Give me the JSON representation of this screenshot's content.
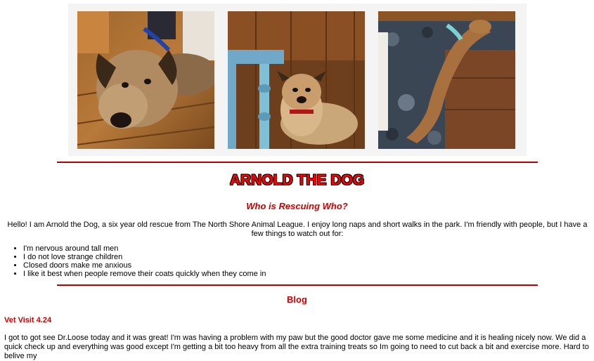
{
  "photos": [
    {
      "alt": "Arnold lying on a wooden floor"
    },
    {
      "alt": "Arnold sitting under a table"
    },
    {
      "alt": "Arnold stretched out on a rug"
    }
  ],
  "header": {
    "title": "ARNOLD THE DOG",
    "subtitle": "Who is Rescuing Who?"
  },
  "intro": {
    "text": "Hello! I am Arnold the Dog, a six year old rescue from The North Shore Animal League. I enjoy long naps and short walks in the park. I'm friendly with people, but I have a few things to watch out for:"
  },
  "watch_list": [
    "I'm nervous around tall men",
    "I do not love strange children",
    "Closed doors make me anxious",
    "I like it best when people remove their coats quickly when they come in"
  ],
  "blog": {
    "heading": "Blog",
    "post_title": "Vet Visit 4.24",
    "post_body": "I got to got see Dr.Loose today and it was great! I'm was having a problem with my paw but the good doctor gave me some medicine and it is healing nicely now. We did a quick check up and everything was good except I'm getting a bit too heavy from all the extra training treats so Im going to need to cut back a bit and exercise more. Hard to belive my"
  },
  "colors": {
    "accent_red": "#cc0000",
    "rule_red": "#b30000",
    "title_red": "#ff0000"
  }
}
